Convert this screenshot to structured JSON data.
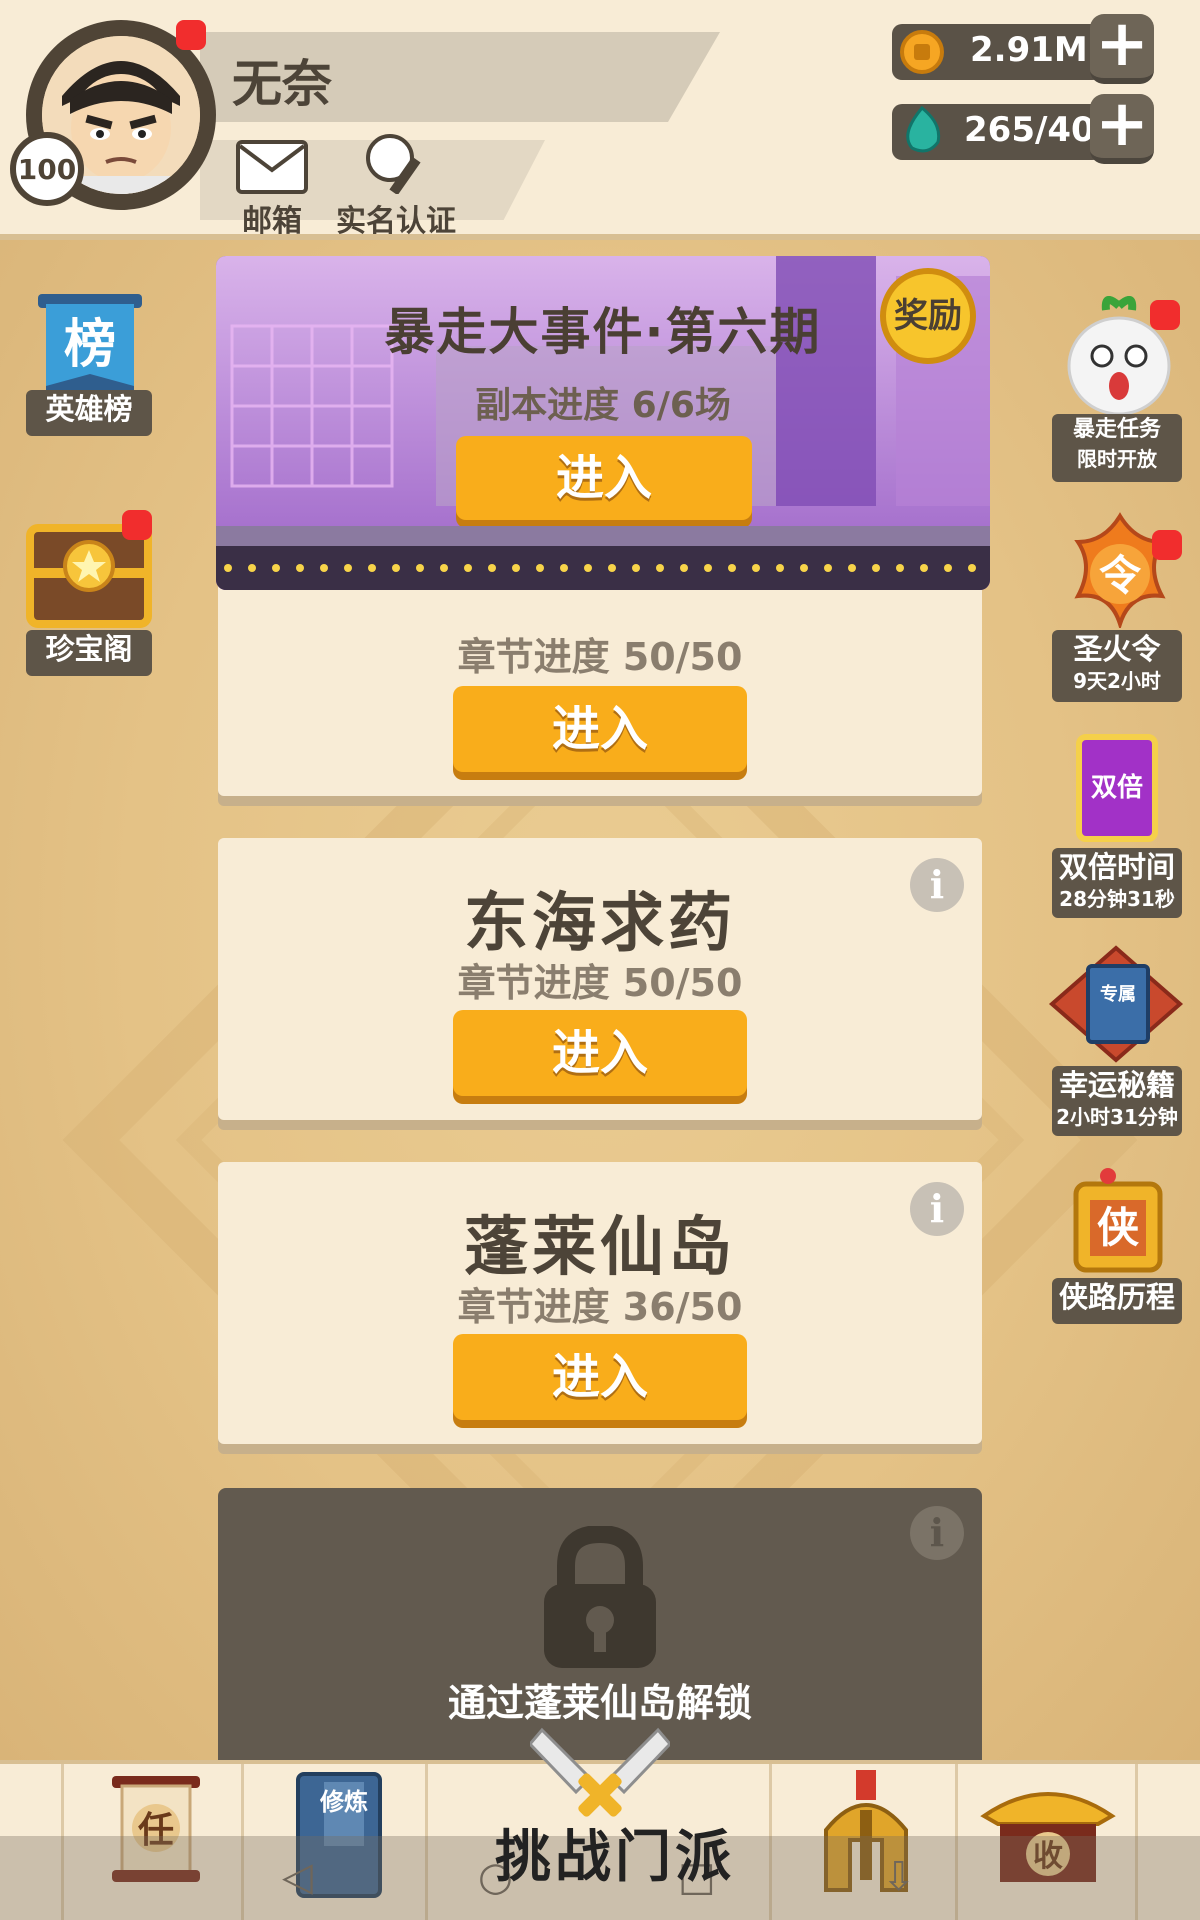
{
  "player": {
    "name": "无奈",
    "level": "100"
  },
  "header": {
    "mail_label": "邮箱",
    "verify_label": "实名认证"
  },
  "resources": {
    "gold": "2.91M",
    "gems": "265/40"
  },
  "left_side": {
    "hero_rank_label": "英雄榜",
    "treasure_label": "珍宝阁"
  },
  "right_side": {
    "rampage_task": {
      "line1": "暴走任务",
      "line2": "限时开放"
    },
    "holy_fire": {
      "line1": "圣火令",
      "line2": "9天2小时"
    },
    "double_time": {
      "line1": "双倍时间",
      "line2": "28分钟31秒"
    },
    "lucky_book": {
      "line1": "幸运秘籍",
      "line2": "2小时31分钟"
    },
    "hero_path": {
      "line1": "侠路历程"
    }
  },
  "event": {
    "title": "暴走大事件·第六期",
    "reward_badge": "奖励",
    "progress": "副本进度 6/6场",
    "enter": "进入"
  },
  "chapters": [
    {
      "title": "",
      "progress": "章节进度 50/50",
      "enter": "进入"
    },
    {
      "title": "东海求药",
      "progress": "章节进度 50/50",
      "enter": "进入"
    },
    {
      "title": "蓬莱仙岛",
      "progress": "章节进度 36/50",
      "enter": "进入"
    }
  ],
  "locked": {
    "text": "通过蓬莱仙岛解锁"
  },
  "bottom_nav": {
    "task_glyph": "任",
    "train_glyph": "修炼",
    "center_label": "挑战门派",
    "collect_glyph": "收"
  },
  "icons": {
    "double_glyph": "双倍",
    "holy_glyph": "令",
    "hero_glyph": "侠",
    "rank_glyph": "榜",
    "book_glyph": "专属"
  }
}
